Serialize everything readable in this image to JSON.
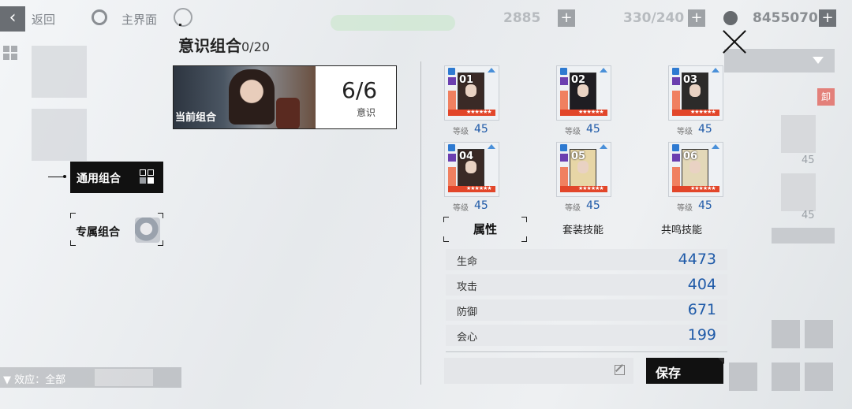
{
  "topbar": {
    "back_label": "返回",
    "home_label": "主界面",
    "network": "",
    "res1": "2885",
    "res2": "330/240",
    "res3": "8455070"
  },
  "modal": {
    "title": "意识组合",
    "count": "0/20",
    "current": {
      "label": "当前组合",
      "value": "6/6",
      "sub": "意识"
    },
    "tabs": {
      "general": "通用组合",
      "special": "专属组合"
    },
    "chips": [
      {
        "num": "01",
        "lvl_label": "等级",
        "lvl": "45",
        "hair": "#3a2a26"
      },
      {
        "num": "02",
        "lvl_label": "等级",
        "lvl": "45",
        "hair": "#1f1d22"
      },
      {
        "num": "03",
        "lvl_label": "等级",
        "lvl": "45",
        "hair": "#2c2b2a"
      },
      {
        "num": "04",
        "lvl_label": "等级",
        "lvl": "45",
        "hair": "#3a2a26"
      },
      {
        "num": "05",
        "lvl_label": "等级",
        "lvl": "45",
        "hair": "#e7d6a6"
      },
      {
        "num": "06",
        "lvl_label": "等级",
        "lvl": "45",
        "hair": "#e3d8b8"
      }
    ],
    "stat_tabs": {
      "attr": "属性",
      "set": "套装技能",
      "resonance": "共鸣技能"
    },
    "stats": [
      {
        "name": "生命",
        "value": "4473"
      },
      {
        "name": "攻击",
        "value": "404"
      },
      {
        "name": "防御",
        "value": "671"
      },
      {
        "name": "会心",
        "value": "199"
      }
    ],
    "save_label": "保存"
  },
  "left_panel": {
    "effect_label": "▼ 效应：全部"
  },
  "right_panel": {
    "badge": "卸",
    "lvl": "45"
  }
}
